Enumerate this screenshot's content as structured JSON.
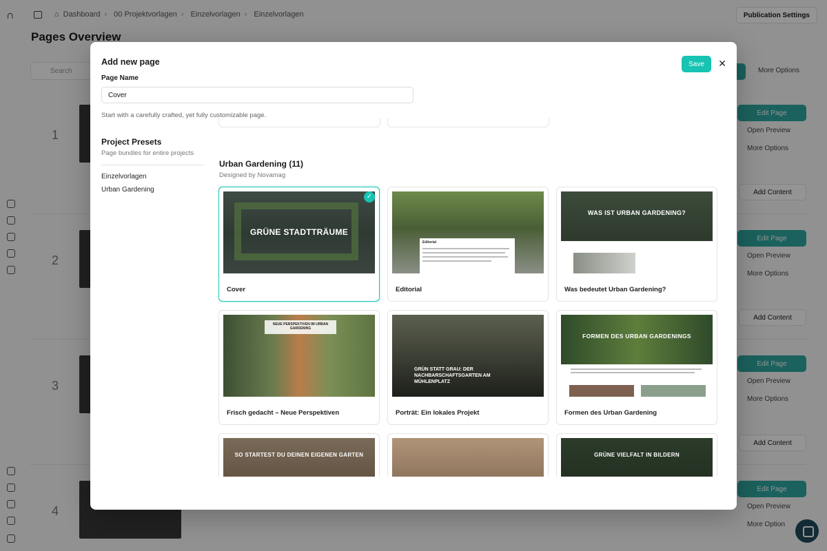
{
  "background": {
    "breadcrumbs": [
      "Dashboard",
      "00 Projektvorlagen",
      "Einzelvorlagen",
      "Einzelvorlagen"
    ],
    "publication_settings": "Publication Settings",
    "page_title": "Pages Overview",
    "search_placeholder": "Search",
    "more_options": "More Options",
    "rows": [
      {
        "num": "1",
        "edit": "Edit Page",
        "preview": "Open Preview",
        "more": "More Options",
        "add": "Add Content"
      },
      {
        "num": "2",
        "edit": "Edit Page",
        "preview": "Open Preview",
        "more": "More Options",
        "add": "Add Content"
      },
      {
        "num": "3",
        "edit": "Edit Page",
        "preview": "Open Preview",
        "more": "More Options",
        "add": "Add Content"
      },
      {
        "num": "4",
        "edit": "Edit Page",
        "preview": "Open Preview",
        "more": "More Option"
      }
    ]
  },
  "modal": {
    "title": "Add new page",
    "save_label": "Save",
    "close_icon": "close-icon",
    "field_label": "Page Name",
    "name_value": "Cover",
    "helper": "Start with a carefully crafted, yet fully customizable page.",
    "presets_title": "Project Presets",
    "presets_sub": "Page bundles for entire projects",
    "preset_links": [
      "Einzelvorlagen",
      "Urban Gardening"
    ],
    "section_title": "Urban Gardening (11)",
    "section_sub": "Designed by Novamag",
    "cards": [
      {
        "label": "Cover",
        "headline": "Grüne Stadtträume",
        "selected": true
      },
      {
        "label": "Editorial",
        "headline": "Editorial"
      },
      {
        "label": "Was bedeutet Urban Gardening?",
        "headline": "Was ist Urban Gardening?"
      },
      {
        "label": "Frisch gedacht – Neue Perspektiven",
        "headline": "Neue Perspektiven im Urban Gardening"
      },
      {
        "label": "Porträt: Ein lokales Projekt",
        "headline": "Grün statt Grau: Der Nachbarschaftsgarten am Mühlenplatz"
      },
      {
        "label": "Formen des Urban Gardening",
        "headline": "Formen des Urban Gardenings"
      },
      {
        "label": "",
        "headline": "So startest du deinen eigenen Garten"
      },
      {
        "label": "",
        "headline": ""
      },
      {
        "label": "",
        "headline": "Grüne Vielfalt in Bildern"
      }
    ]
  },
  "colors": {
    "accent": "#17c3b2"
  }
}
